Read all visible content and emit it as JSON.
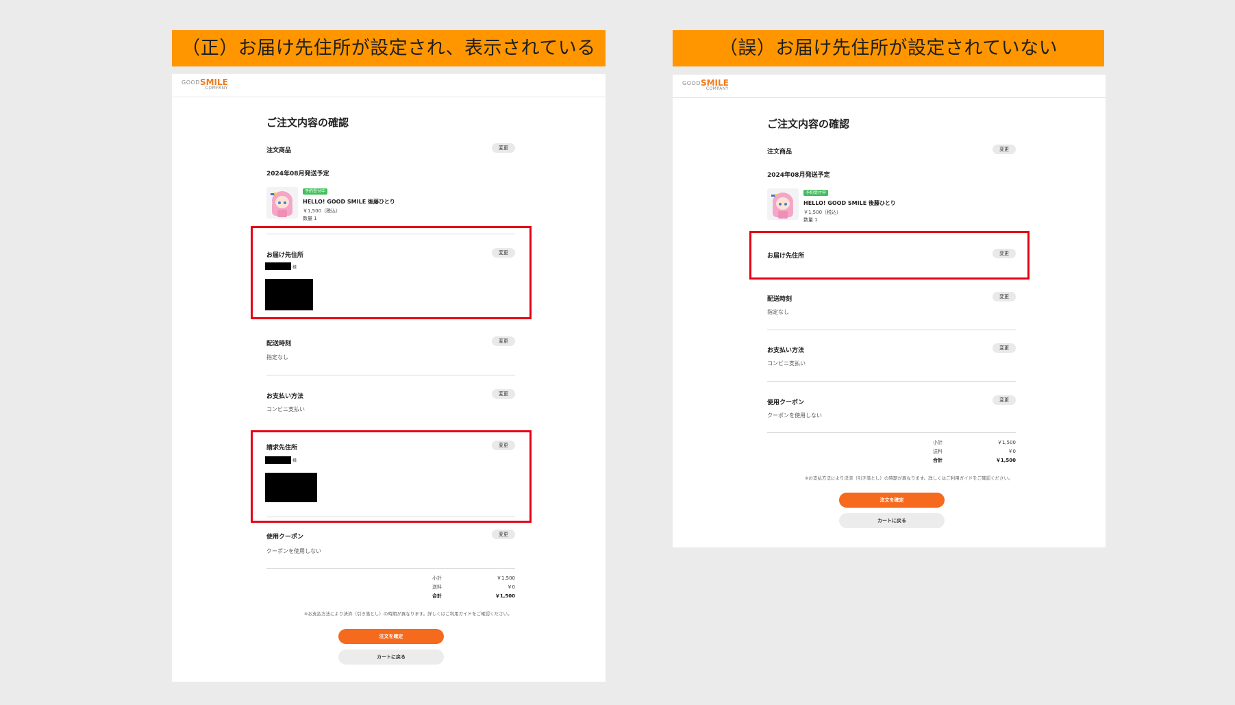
{
  "left": {
    "banner": "（正）お届け先住所が設定され、表示されている",
    "logo": {
      "good": "GOOD",
      "smile": "SMILE",
      "company": "COMPANY"
    },
    "title": "ご注文内容の確認",
    "items_label": "注文商品",
    "change": "変更",
    "ship_date": "2024年08月発送予定",
    "product": {
      "badge": "予約受付中",
      "name": "HELLO! GOOD SMILE 後藤ひとり",
      "price": "￥1,500（税込）",
      "qty": "数量 1"
    },
    "shipping_label": "お届け先住所",
    "shipping_suffix": "様",
    "time_label": "配送時刻",
    "time_value": "指定なし",
    "payment_label": "お支払い方法",
    "payment_value": "コンビニ支払い",
    "billing_label": "請求先住所",
    "billing_suffix": "様",
    "coupon_label": "使用クーポン",
    "coupon_value": "クーポンを使用しない",
    "subtotal_label": "小計",
    "subtotal_value": "￥1,500",
    "shipping_fee_label": "送料",
    "shipping_fee_value": "￥0",
    "total_label": "合計",
    "total_value": "￥1,500",
    "note": "※お支払方法により決済（引き落とし）の時期が異なります。詳しくはご利用ガイドをご確認ください。",
    "confirm_btn": "注文を確定",
    "cart_btn": "カートに戻る"
  },
  "right": {
    "banner": "（誤）お届け先住所が設定されていない",
    "logo": {
      "good": "GOOD",
      "smile": "SMILE",
      "company": "COMPANY"
    },
    "title": "ご注文内容の確認",
    "items_label": "注文商品",
    "change": "変更",
    "ship_date": "2024年08月発送予定",
    "product": {
      "badge": "予約受付中",
      "name": "HELLO! GOOD SMILE 後藤ひとり",
      "price": "￥1,500（税込）",
      "qty": "数量 1"
    },
    "shipping_label": "お届け先住所",
    "time_label": "配送時刻",
    "time_value": "指定なし",
    "payment_label": "お支払い方法",
    "payment_value": "コンビニ支払い",
    "coupon_label": "使用クーポン",
    "coupon_value": "クーポンを使用しない",
    "subtotal_label": "小計",
    "subtotal_value": "￥1,500",
    "shipping_fee_label": "送料",
    "shipping_fee_value": "￥0",
    "total_label": "合計",
    "total_value": "￥1,500",
    "note": "※お支払方法により決済（引き落とし）の時期が異なります。詳しくはご利用ガイドをご確認ください。",
    "confirm_btn": "注文を確定",
    "cart_btn": "カートに戻る"
  },
  "colors": {
    "banner": "#ff9600",
    "highlight": "#e60012",
    "confirm": "#f56a1c",
    "logo": "#f07b1a"
  }
}
